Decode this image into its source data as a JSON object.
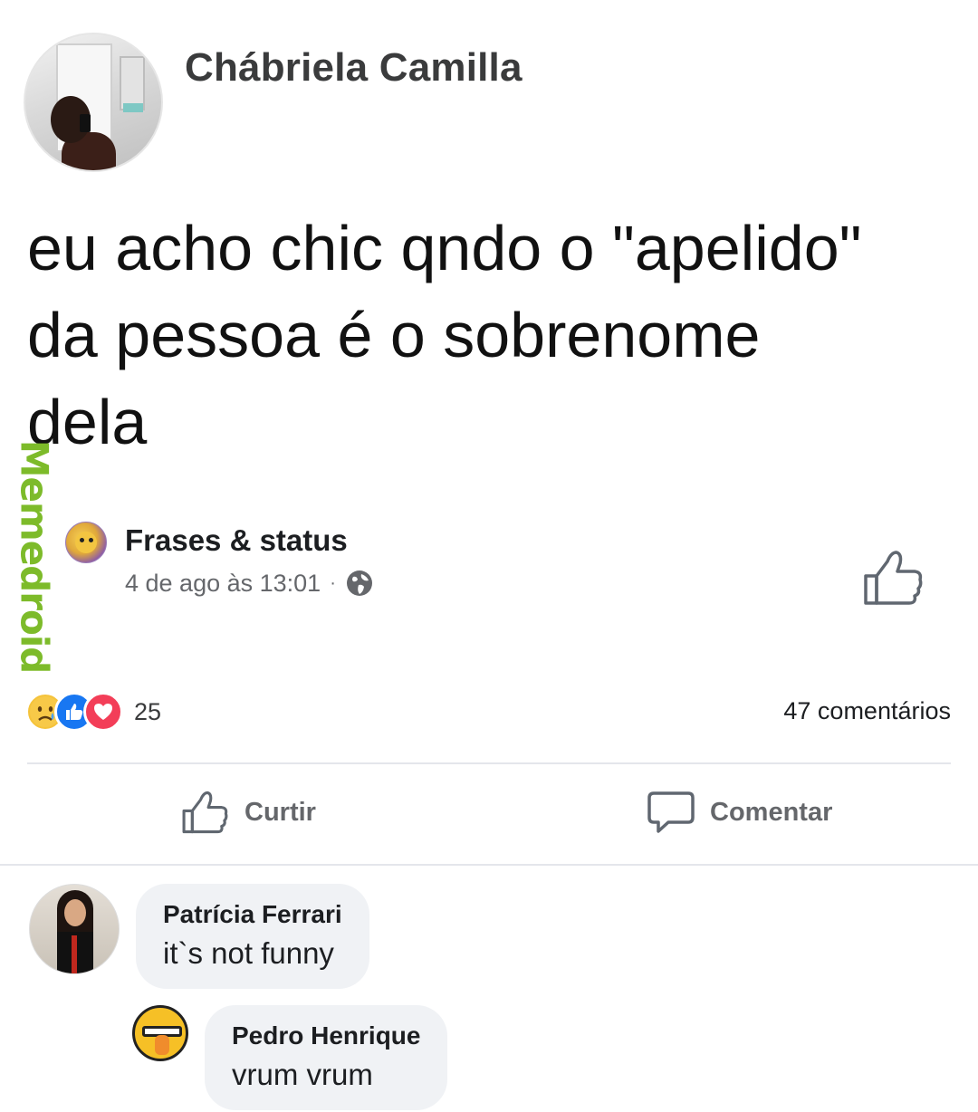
{
  "post": {
    "author": "Chábriela Camilla",
    "text_line_1": "eu acho chic qndo o \"apelido\"",
    "text_line_2": "da pessoa é o sobrenome",
    "text_line_3": "dela"
  },
  "watermark": "Memedroid",
  "page": {
    "name": "Frases & status",
    "timestamp": "4 de ago às 13:01",
    "separator": "·",
    "privacy_icon": "globe-icon"
  },
  "reactions": {
    "icons": [
      "sad-face-icon",
      "like-icon",
      "love-icon"
    ],
    "count": "25",
    "comments_count": "47 comentários"
  },
  "actions": {
    "like_label": "Curtir",
    "comment_label": "Comentar"
  },
  "comments": [
    {
      "name": "Patrícia Ferrari",
      "text": "it`s not funny"
    },
    {
      "name": "Pedro Henrique",
      "text": "vrum vrum"
    }
  ],
  "colors": {
    "accent_blue": "#1877f2",
    "love_red": "#f33e58",
    "sad_yellow": "#f5c33b",
    "watermark_green": "#7dbb2a",
    "muted_text": "#65676b",
    "bubble_bg": "#f0f2f5"
  }
}
